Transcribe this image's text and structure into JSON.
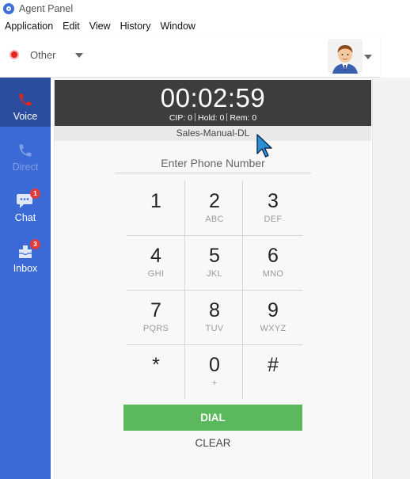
{
  "window": {
    "title": "Agent Panel"
  },
  "menu": [
    {
      "label": "Application"
    },
    {
      "label": "Edit"
    },
    {
      "label": "View"
    },
    {
      "label": "History"
    },
    {
      "label": "Window"
    }
  ],
  "status": {
    "label": "Other",
    "color": "#e0231d"
  },
  "sidebar": {
    "items": [
      {
        "label": "Voice",
        "icon": "phone-icon",
        "state": "active"
      },
      {
        "label": "Direct",
        "icon": "phone-icon",
        "state": "disabled"
      },
      {
        "label": "Chat",
        "icon": "chat-icon",
        "badge": "1"
      },
      {
        "label": "Inbox",
        "icon": "inbox-icon",
        "badge": "3"
      }
    ]
  },
  "call": {
    "timer": "00:02:59",
    "cip": "CIP: 0",
    "hold": "Hold: 0",
    "rem": "Rem: 0",
    "queue": "Sales-Manual-DL"
  },
  "dialer": {
    "placeholder": "Enter Phone Number",
    "value": "",
    "keys": [
      {
        "digit": "1",
        "letters": ""
      },
      {
        "digit": "2",
        "letters": "ABC"
      },
      {
        "digit": "3",
        "letters": "DEF"
      },
      {
        "digit": "4",
        "letters": "GHI"
      },
      {
        "digit": "5",
        "letters": "JKL"
      },
      {
        "digit": "6",
        "letters": "MNO"
      },
      {
        "digit": "7",
        "letters": "PQRS"
      },
      {
        "digit": "8",
        "letters": "TUV"
      },
      {
        "digit": "9",
        "letters": "WXYZ"
      },
      {
        "digit": "*",
        "letters": ""
      },
      {
        "digit": "0",
        "letters": "+"
      },
      {
        "digit": "#",
        "letters": ""
      }
    ],
    "dial_label": "DIAL",
    "clear_label": "CLEAR",
    "dial_color": "#5cb85c"
  },
  "colors": {
    "sidebar": "#3b69d6",
    "sidebar_active": "#2a4d9e",
    "timer_bg": "#3d3d3d"
  }
}
